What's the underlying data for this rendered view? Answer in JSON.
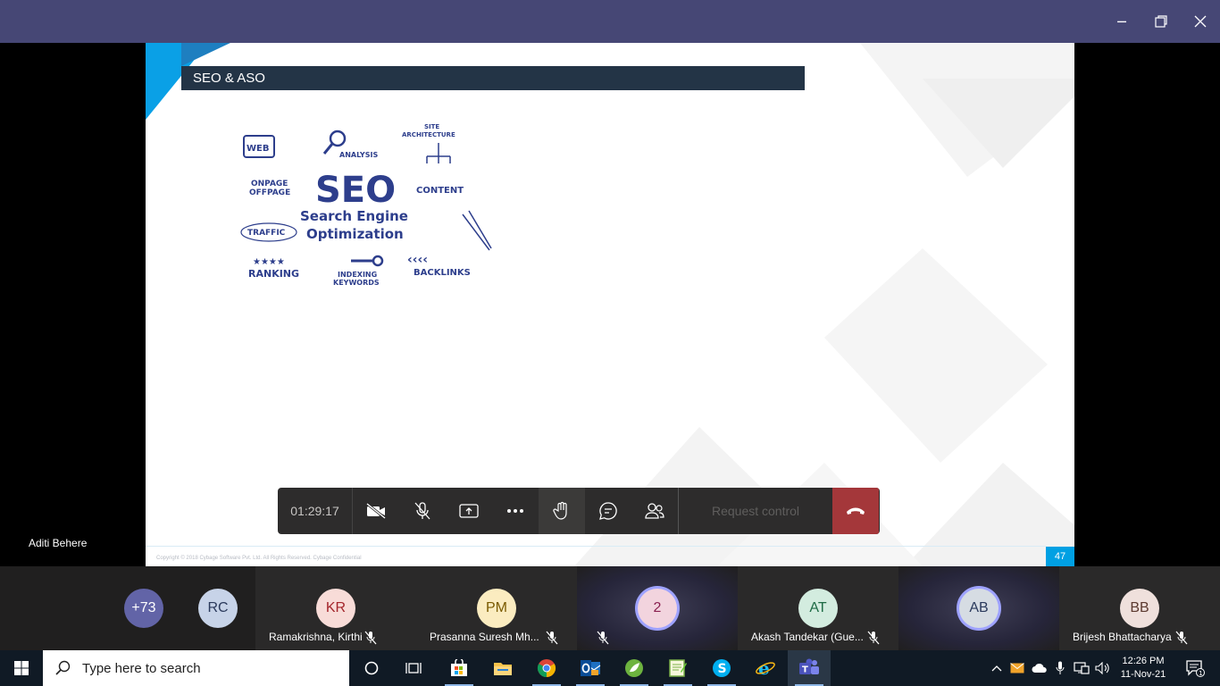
{
  "window": {
    "minimize": "─",
    "restore": "❐",
    "close": "✕",
    "titlebar_color": "#464775"
  },
  "slide": {
    "title": "SEO & ASO",
    "footer": "Copyright © 2018 Cybage Software Pvt. Ltd. All Rights Reserved. Cybage Confidential",
    "page_number": "47",
    "graphic": {
      "main": "SEO",
      "line1": "Search Engine",
      "line2": "Optimization",
      "web": "WEB",
      "analysis": "ANALYSIS",
      "site1": "SITE",
      "site2": "ARCHITECTURE",
      "onpage": "ONPAGE",
      "offpage": "OFFPAGE",
      "content": "CONTENT",
      "traffic": "TRAFFIC",
      "ranking": "RANKING",
      "indexing": "INDEXING",
      "keywords": "KEYWORDS",
      "backlinks": "BACKLINKS",
      "stars": "★★★★",
      "arrows": "‹‹‹‹"
    }
  },
  "controls": {
    "timer": "01:29:17",
    "request_control": "Request control",
    "icons": [
      "camera-off-icon",
      "mic-off-icon",
      "share-screen-icon",
      "more-icon",
      "raise-hand-icon",
      "chat-icon",
      "participants-icon",
      "hang-up-icon"
    ]
  },
  "presenter": {
    "name": "Aditi Behere"
  },
  "participants": [
    {
      "initials": "+73",
      "name": "",
      "color": "#6264a7",
      "text_color": "#ffffff"
    },
    {
      "initials": "RC",
      "name": "",
      "color": "#c7d3e8",
      "text_color": "#2b3a5c"
    },
    {
      "initials": "KR",
      "name": "Ramakrishna, Kirthi",
      "color": "#f8dcd8",
      "text_color": "#a4262c"
    },
    {
      "initials": "PM",
      "name": "Prasanna Suresh Mh...",
      "color": "#fbecc0",
      "text_color": "#7a5a00"
    },
    {
      "initials": "2",
      "name": "",
      "color": "#f2d4de",
      "text_color": "#8a2050"
    },
    {
      "initials": "AT",
      "name": "Akash Tandekar (Gue...",
      "color": "#d3ecdf",
      "text_color": "#1e6b45"
    },
    {
      "initials": "AB",
      "name": "",
      "color": "#d6dce3",
      "text_color": "#2b3a5c"
    },
    {
      "initials": "BB",
      "name": "Brijesh Bhattacharya",
      "color": "#efe0dc",
      "text_color": "#5c3a30"
    }
  ],
  "taskbar": {
    "search_placeholder": "Type here to search",
    "time": "12:26 PM",
    "date": "11-Nov-21",
    "notifications": "1",
    "apps": [
      "cortana-icon",
      "task-view-icon",
      "store-icon",
      "file-explorer-icon",
      "chrome-icon",
      "outlook-icon",
      "spring-icon",
      "notepad-plus-icon",
      "skype-icon",
      "internet-explorer-icon",
      "teams-icon"
    ]
  }
}
